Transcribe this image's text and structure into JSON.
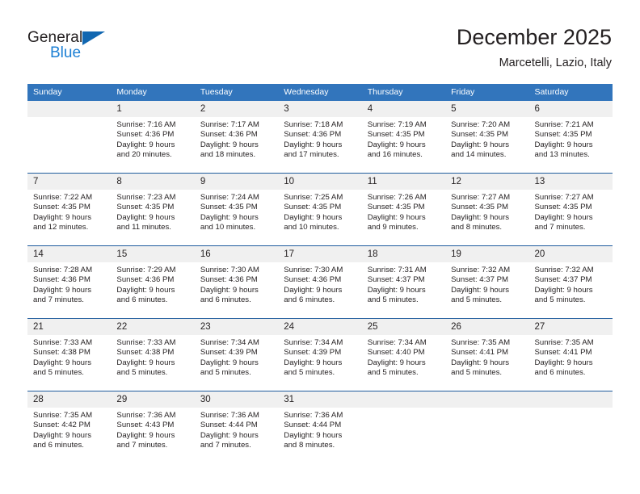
{
  "brand": {
    "name_part1": "General",
    "name_part2": "Blue",
    "triangle_color": "#1167b1",
    "blue_color": "#1b7fd4"
  },
  "header": {
    "title": "December 2025",
    "subtitle": "Marcetelli, Lazio, Italy",
    "header_bg": "#3275bc",
    "separator_color": "#1f5c9e",
    "daynum_bg": "#f0f0f0"
  },
  "weekdays": [
    "Sunday",
    "Monday",
    "Tuesday",
    "Wednesday",
    "Thursday",
    "Friday",
    "Saturday"
  ],
  "weeks": [
    [
      {
        "day": "",
        "sunrise": "",
        "sunset": "",
        "daylight1": "",
        "daylight2": ""
      },
      {
        "day": "1",
        "sunrise": "Sunrise: 7:16 AM",
        "sunset": "Sunset: 4:36 PM",
        "daylight1": "Daylight: 9 hours",
        "daylight2": "and 20 minutes."
      },
      {
        "day": "2",
        "sunrise": "Sunrise: 7:17 AM",
        "sunset": "Sunset: 4:36 PM",
        "daylight1": "Daylight: 9 hours",
        "daylight2": "and 18 minutes."
      },
      {
        "day": "3",
        "sunrise": "Sunrise: 7:18 AM",
        "sunset": "Sunset: 4:36 PM",
        "daylight1": "Daylight: 9 hours",
        "daylight2": "and 17 minutes."
      },
      {
        "day": "4",
        "sunrise": "Sunrise: 7:19 AM",
        "sunset": "Sunset: 4:35 PM",
        "daylight1": "Daylight: 9 hours",
        "daylight2": "and 16 minutes."
      },
      {
        "day": "5",
        "sunrise": "Sunrise: 7:20 AM",
        "sunset": "Sunset: 4:35 PM",
        "daylight1": "Daylight: 9 hours",
        "daylight2": "and 14 minutes."
      },
      {
        "day": "6",
        "sunrise": "Sunrise: 7:21 AM",
        "sunset": "Sunset: 4:35 PM",
        "daylight1": "Daylight: 9 hours",
        "daylight2": "and 13 minutes."
      }
    ],
    [
      {
        "day": "7",
        "sunrise": "Sunrise: 7:22 AM",
        "sunset": "Sunset: 4:35 PM",
        "daylight1": "Daylight: 9 hours",
        "daylight2": "and 12 minutes."
      },
      {
        "day": "8",
        "sunrise": "Sunrise: 7:23 AM",
        "sunset": "Sunset: 4:35 PM",
        "daylight1": "Daylight: 9 hours",
        "daylight2": "and 11 minutes."
      },
      {
        "day": "9",
        "sunrise": "Sunrise: 7:24 AM",
        "sunset": "Sunset: 4:35 PM",
        "daylight1": "Daylight: 9 hours",
        "daylight2": "and 10 minutes."
      },
      {
        "day": "10",
        "sunrise": "Sunrise: 7:25 AM",
        "sunset": "Sunset: 4:35 PM",
        "daylight1": "Daylight: 9 hours",
        "daylight2": "and 10 minutes."
      },
      {
        "day": "11",
        "sunrise": "Sunrise: 7:26 AM",
        "sunset": "Sunset: 4:35 PM",
        "daylight1": "Daylight: 9 hours",
        "daylight2": "and 9 minutes."
      },
      {
        "day": "12",
        "sunrise": "Sunrise: 7:27 AM",
        "sunset": "Sunset: 4:35 PM",
        "daylight1": "Daylight: 9 hours",
        "daylight2": "and 8 minutes."
      },
      {
        "day": "13",
        "sunrise": "Sunrise: 7:27 AM",
        "sunset": "Sunset: 4:35 PM",
        "daylight1": "Daylight: 9 hours",
        "daylight2": "and 7 minutes."
      }
    ],
    [
      {
        "day": "14",
        "sunrise": "Sunrise: 7:28 AM",
        "sunset": "Sunset: 4:36 PM",
        "daylight1": "Daylight: 9 hours",
        "daylight2": "and 7 minutes."
      },
      {
        "day": "15",
        "sunrise": "Sunrise: 7:29 AM",
        "sunset": "Sunset: 4:36 PM",
        "daylight1": "Daylight: 9 hours",
        "daylight2": "and 6 minutes."
      },
      {
        "day": "16",
        "sunrise": "Sunrise: 7:30 AM",
        "sunset": "Sunset: 4:36 PM",
        "daylight1": "Daylight: 9 hours",
        "daylight2": "and 6 minutes."
      },
      {
        "day": "17",
        "sunrise": "Sunrise: 7:30 AM",
        "sunset": "Sunset: 4:36 PM",
        "daylight1": "Daylight: 9 hours",
        "daylight2": "and 6 minutes."
      },
      {
        "day": "18",
        "sunrise": "Sunrise: 7:31 AM",
        "sunset": "Sunset: 4:37 PM",
        "daylight1": "Daylight: 9 hours",
        "daylight2": "and 5 minutes."
      },
      {
        "day": "19",
        "sunrise": "Sunrise: 7:32 AM",
        "sunset": "Sunset: 4:37 PM",
        "daylight1": "Daylight: 9 hours",
        "daylight2": "and 5 minutes."
      },
      {
        "day": "20",
        "sunrise": "Sunrise: 7:32 AM",
        "sunset": "Sunset: 4:37 PM",
        "daylight1": "Daylight: 9 hours",
        "daylight2": "and 5 minutes."
      }
    ],
    [
      {
        "day": "21",
        "sunrise": "Sunrise: 7:33 AM",
        "sunset": "Sunset: 4:38 PM",
        "daylight1": "Daylight: 9 hours",
        "daylight2": "and 5 minutes."
      },
      {
        "day": "22",
        "sunrise": "Sunrise: 7:33 AM",
        "sunset": "Sunset: 4:38 PM",
        "daylight1": "Daylight: 9 hours",
        "daylight2": "and 5 minutes."
      },
      {
        "day": "23",
        "sunrise": "Sunrise: 7:34 AM",
        "sunset": "Sunset: 4:39 PM",
        "daylight1": "Daylight: 9 hours",
        "daylight2": "and 5 minutes."
      },
      {
        "day": "24",
        "sunrise": "Sunrise: 7:34 AM",
        "sunset": "Sunset: 4:39 PM",
        "daylight1": "Daylight: 9 hours",
        "daylight2": "and 5 minutes."
      },
      {
        "day": "25",
        "sunrise": "Sunrise: 7:34 AM",
        "sunset": "Sunset: 4:40 PM",
        "daylight1": "Daylight: 9 hours",
        "daylight2": "and 5 minutes."
      },
      {
        "day": "26",
        "sunrise": "Sunrise: 7:35 AM",
        "sunset": "Sunset: 4:41 PM",
        "daylight1": "Daylight: 9 hours",
        "daylight2": "and 5 minutes."
      },
      {
        "day": "27",
        "sunrise": "Sunrise: 7:35 AM",
        "sunset": "Sunset: 4:41 PM",
        "daylight1": "Daylight: 9 hours",
        "daylight2": "and 6 minutes."
      }
    ],
    [
      {
        "day": "28",
        "sunrise": "Sunrise: 7:35 AM",
        "sunset": "Sunset: 4:42 PM",
        "daylight1": "Daylight: 9 hours",
        "daylight2": "and 6 minutes."
      },
      {
        "day": "29",
        "sunrise": "Sunrise: 7:36 AM",
        "sunset": "Sunset: 4:43 PM",
        "daylight1": "Daylight: 9 hours",
        "daylight2": "and 7 minutes."
      },
      {
        "day": "30",
        "sunrise": "Sunrise: 7:36 AM",
        "sunset": "Sunset: 4:44 PM",
        "daylight1": "Daylight: 9 hours",
        "daylight2": "and 7 minutes."
      },
      {
        "day": "31",
        "sunrise": "Sunrise: 7:36 AM",
        "sunset": "Sunset: 4:44 PM",
        "daylight1": "Daylight: 9 hours",
        "daylight2": "and 8 minutes."
      },
      {
        "day": "",
        "sunrise": "",
        "sunset": "",
        "daylight1": "",
        "daylight2": ""
      },
      {
        "day": "",
        "sunrise": "",
        "sunset": "",
        "daylight1": "",
        "daylight2": ""
      },
      {
        "day": "",
        "sunrise": "",
        "sunset": "",
        "daylight1": "",
        "daylight2": ""
      }
    ]
  ]
}
